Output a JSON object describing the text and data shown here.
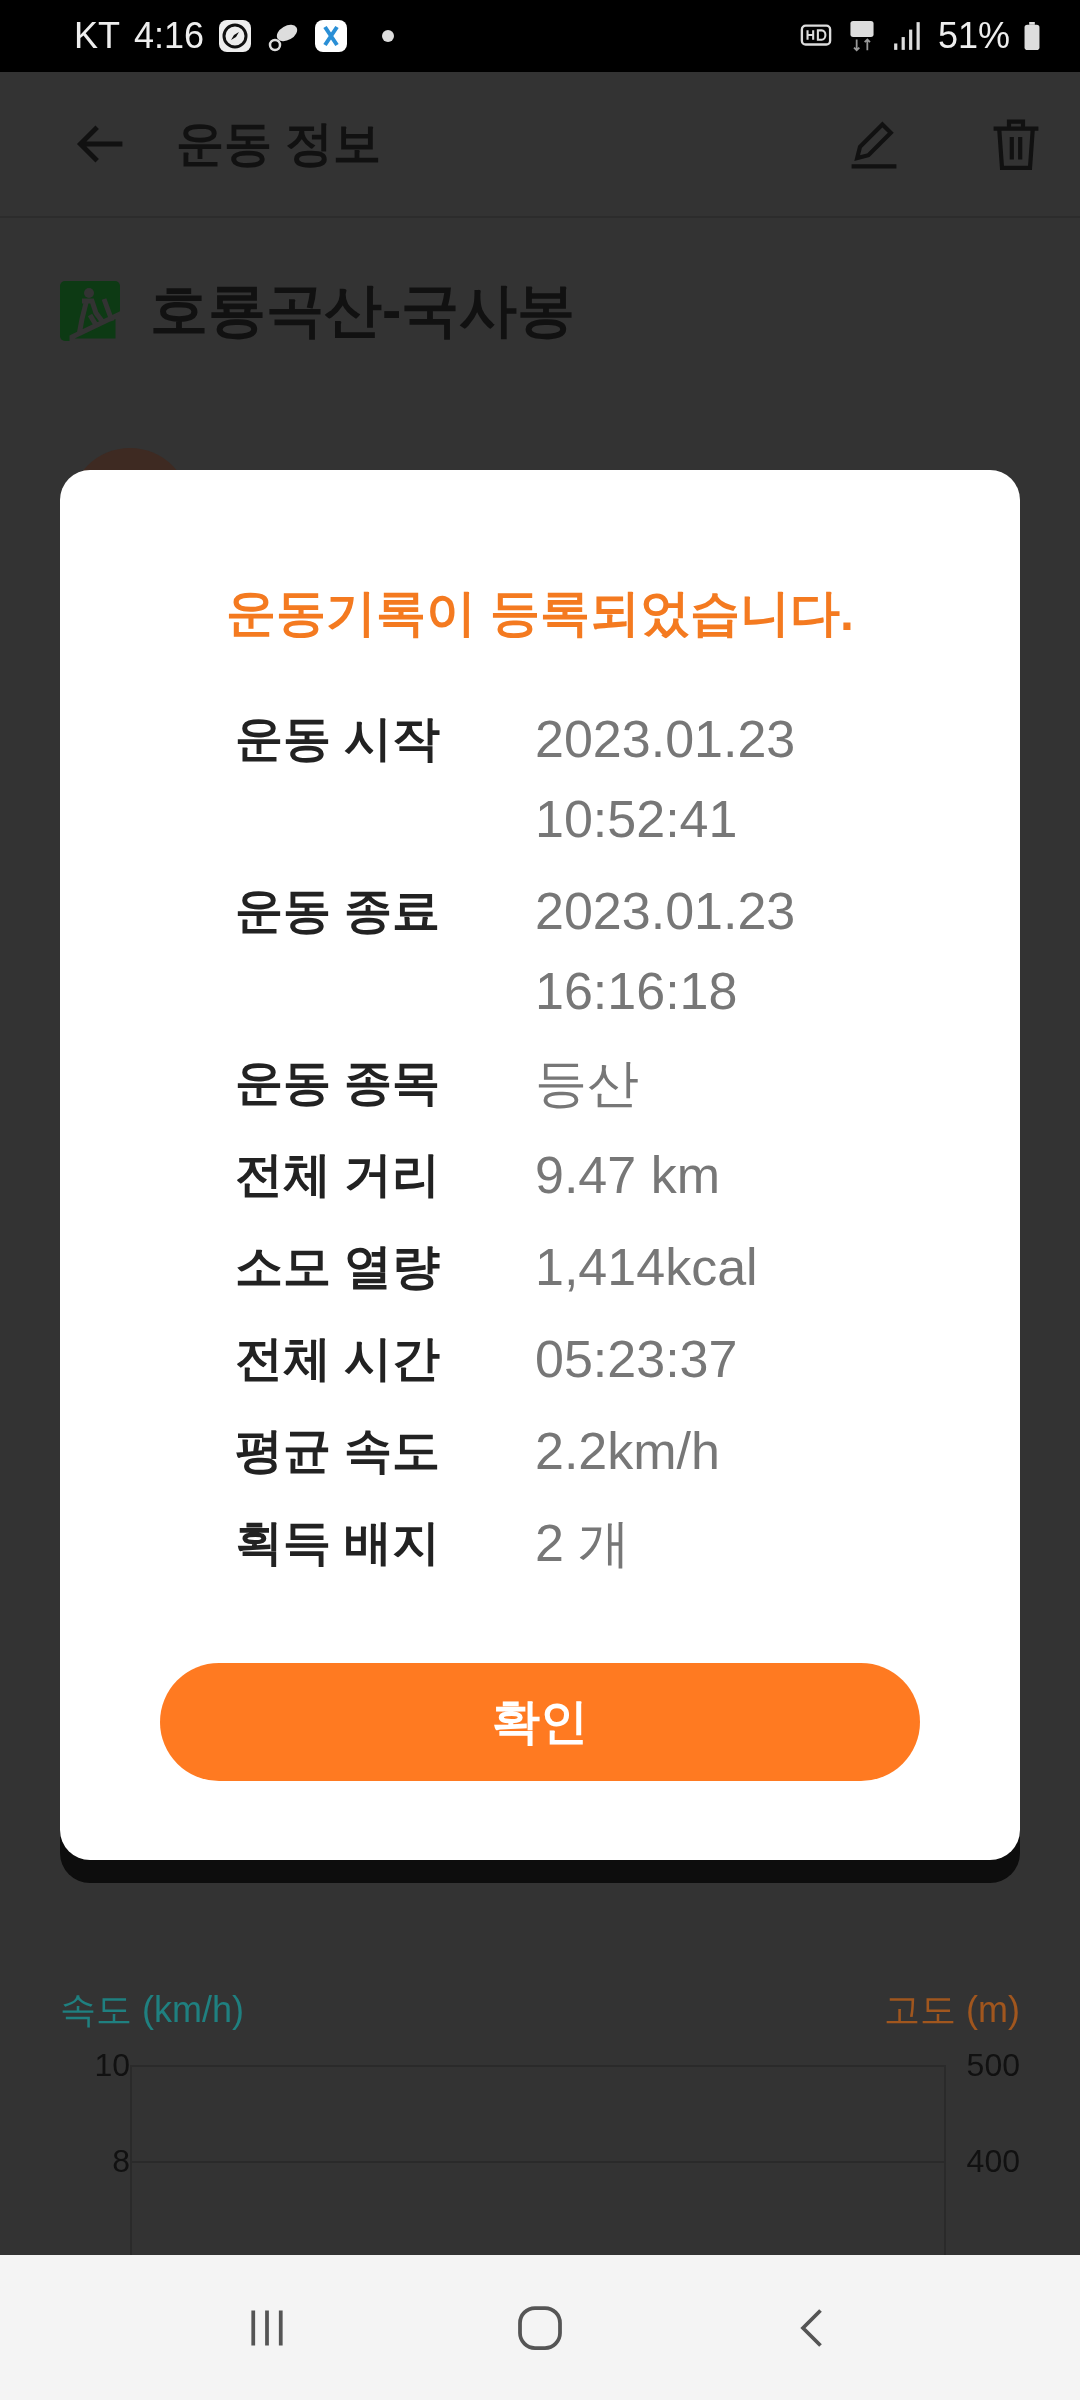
{
  "status_bar": {
    "carrier": "KT",
    "time": "4:16",
    "battery": "51%"
  },
  "header": {
    "title": "운동 정보"
  },
  "activity": {
    "title": "호룡곡산-국사봉"
  },
  "dialog": {
    "message": "운동기록이 등록되었습니다.",
    "rows": [
      {
        "label": "운동 시작",
        "value": [
          "2023.01.23",
          "10:52:41"
        ]
      },
      {
        "label": "운동 종료",
        "value": [
          "2023.01.23",
          "16:16:18"
        ]
      },
      {
        "label": "운동 종목",
        "value": [
          "등산"
        ]
      },
      {
        "label": "전체 거리",
        "value": [
          "9.47 km"
        ]
      },
      {
        "label": "소모 열량",
        "value": [
          "1,414kcal"
        ]
      },
      {
        "label": "전체 시간",
        "value": [
          "05:23:37"
        ]
      },
      {
        "label": "평균 속도",
        "value": [
          "2.2km/h"
        ]
      },
      {
        "label": "획득 배지",
        "value": [
          "2 개"
        ]
      }
    ],
    "button": "확인"
  },
  "chart": {
    "left_axis_label": "속도 (km/h)",
    "right_axis_label": "고도 (m)",
    "left_ticks": [
      "10",
      "8"
    ],
    "right_ticks": [
      "500",
      "400"
    ]
  }
}
